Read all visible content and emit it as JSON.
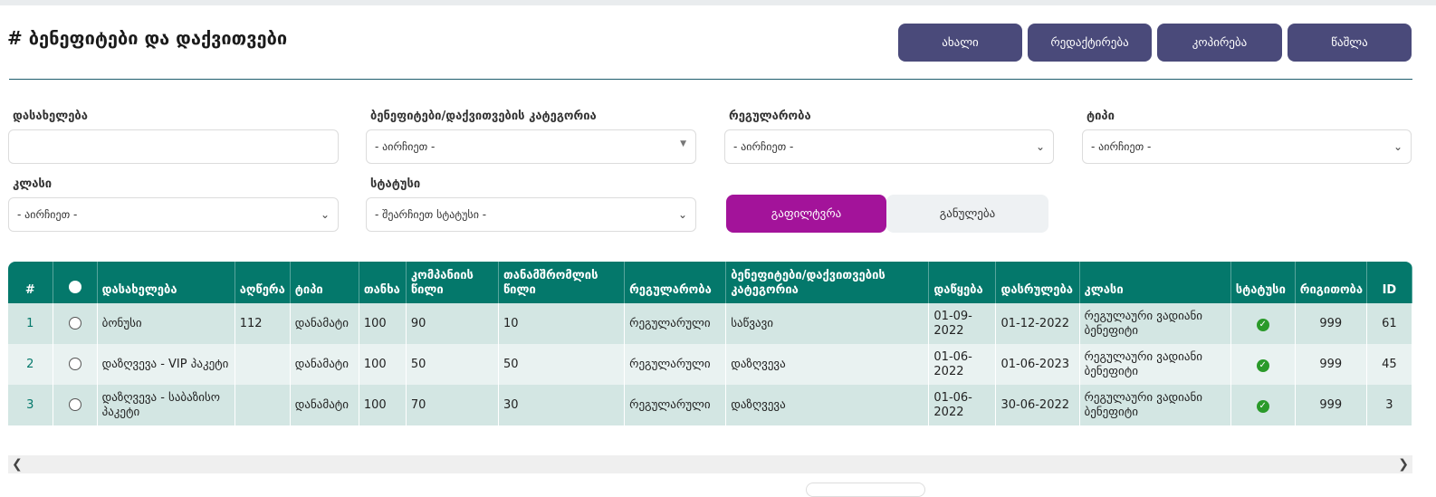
{
  "page": {
    "title": "# ბენეფიტები და დაქვითვები"
  },
  "toolbar": {
    "new_label": "ახალი",
    "edit_label": "რედაქტირება",
    "copy_label": "კოპირება",
    "delete_label": "წაშლა"
  },
  "filters": {
    "name": {
      "label": "დასახელება",
      "value": ""
    },
    "category": {
      "label": "ბენეფიტები/დაქვითვების კატეგორია",
      "value": "- აირჩიეთ -"
    },
    "regularity": {
      "label": "რეგულარობა",
      "value": "- აირჩიეთ -"
    },
    "type": {
      "label": "ტიპი",
      "value": "- აირჩიეთ -"
    },
    "class": {
      "label": "კლასი",
      "value": "- აირჩიეთ -"
    },
    "status": {
      "label": "სტატუსი",
      "value": "- შეარჩიეთ სტატუსი -"
    },
    "filter_label": "გაფილტვრა",
    "reset_label": "განულება"
  },
  "table": {
    "headers": [
      "#",
      "",
      "დასახელება",
      "აღწერა",
      "ტიპი",
      "თანხა",
      "კომპანიის წილი",
      "თანამშრომლის წილი",
      "რეგულარობა",
      "ბენეფიტები/დაქვითვების კატეგორია",
      "დაწყება",
      "დასრულება",
      "კლასი",
      "სტატუსი",
      "რიგითობა",
      "ID"
    ],
    "rows": [
      {
        "num": "1",
        "name": "ბონუსი",
        "desc": "112",
        "type": "დანამატი",
        "amount": "100",
        "company": "90",
        "employee": "10",
        "regularity": "რეგულარული",
        "category": "საწვავი",
        "start": "01-09-2022",
        "end": "01-12-2022",
        "class": "რეგულაური ვადიანი ბენეფიტი",
        "status": "active",
        "order": "999",
        "id": "61"
      },
      {
        "num": "2",
        "name": "დაზღვევა - VIP პაკეტი",
        "desc": "",
        "type": "დანამატი",
        "amount": "100",
        "company": "50",
        "employee": "50",
        "regularity": "რეგულარული",
        "category": "დაზღვევა",
        "start": "01-06-2022",
        "end": "01-06-2023",
        "class": "რეგულაური ვადიანი ბენეფიტი",
        "status": "active",
        "order": "999",
        "id": "45"
      },
      {
        "num": "3",
        "name": "დაზღვევა - საბაზისო პაკეტი",
        "desc": "",
        "type": "დანამატი",
        "amount": "100",
        "company": "70",
        "employee": "30",
        "regularity": "რეგულარული",
        "category": "დაზღვევა",
        "start": "01-06-2022",
        "end": "30-06-2022",
        "class": "რეგულაური ვადიანი ბენეფიტი",
        "status": "active",
        "order": "999",
        "id": "3"
      }
    ]
  },
  "colors": {
    "primary": "#4a4a7a",
    "table_header": "#04786b",
    "filter_button": "#a3139a",
    "status_ok": "#2a9a2a"
  }
}
